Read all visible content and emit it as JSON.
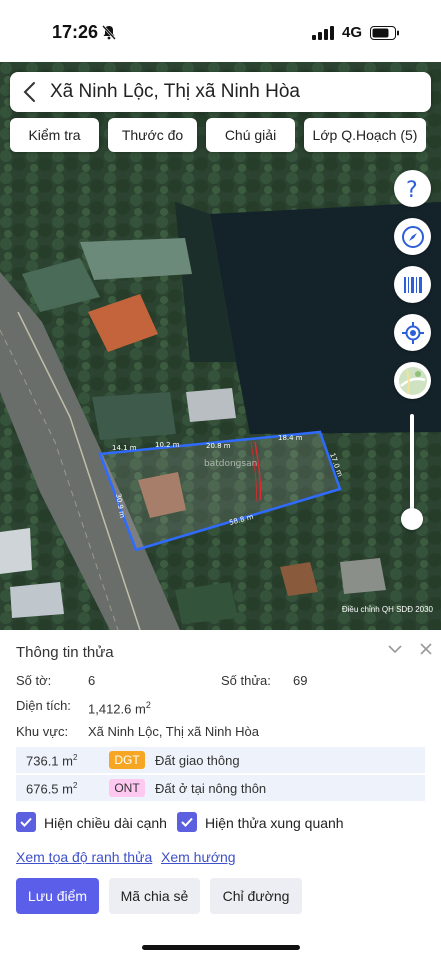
{
  "status": {
    "time": "17:26",
    "network": "4G"
  },
  "search": {
    "title": "Xã Ninh Lộc, Thị xã Ninh Hòa"
  },
  "toolbar": [
    "Kiểm tra",
    "Thước đo",
    "Chú giải",
    "Lớp Q.Hoạch (5)"
  ],
  "map": {
    "credit": "Điều chỉnh QH SDĐ 2030",
    "segments": [
      "14.1 m",
      "10.2 m",
      "20.8 m",
      "18.4 m",
      "17.0 m",
      "58.8 m",
      "30.9 m"
    ],
    "watermark": "batdongsan",
    "parcel_color": "#2f6bff"
  },
  "fabs": [
    "help-icon",
    "compass-icon",
    "barcode-icon",
    "locate-icon",
    "map-layer-icon"
  ],
  "panel": {
    "title": "Thông tin thửa",
    "so_to_label": "Số tờ:",
    "so_to_value": "6",
    "so_thua_label": "Số thửa:",
    "so_thua_value": "69",
    "dien_tich_label": "Diện tích:",
    "dien_tich_value": "1,412.6 m",
    "dien_tich_unit": "2",
    "khu_vuc_label": "Khu vực:",
    "khu_vuc_value": "Xã Ninh Lộc, Thị xã Ninh Hòa",
    "land_uses": [
      {
        "area": "736.1 m",
        "sup": "2",
        "code": "DGT",
        "desc": "Đất giao thông",
        "bg": "#f6a623",
        "fg": "#fff"
      },
      {
        "area": "676.5 m",
        "sup": "2",
        "code": "ONT",
        "desc": "Đất ở tại nông thôn",
        "bg": "#ffc8f0",
        "fg": "#333"
      }
    ],
    "chk_edges": "Hiện chiều dài cạnh",
    "chk_neighbors": "Hiện thửa xung quanh",
    "link_coords": "Xem tọa độ ranh thửa",
    "link_direction": "Xem hướng",
    "btn_save": "Lưu điểm",
    "btn_share": "Mã chia sẻ",
    "btn_directions": "Chỉ đường"
  }
}
